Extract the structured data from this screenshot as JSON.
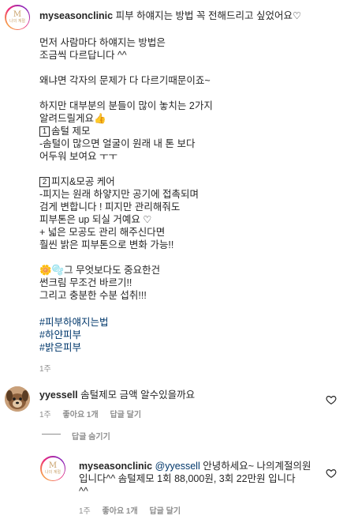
{
  "post": {
    "username": "myseasonclinic",
    "logo_text": "나의 계절",
    "first_line": "피부 하얘지는 방법 꼭 전해드리고 싶었어요♡",
    "lines": [
      "먼저 사람마다 하얘지는 방법은",
      "조금씩 다르답니다 ^^",
      "",
      "왜냐면 각자의 문제가 다 다르기때문이죠~",
      "",
      "하지만 대부분의 분들이 많이 놓치는 2가지",
      "알려드릴게요👍",
      "",
      "-솜털이 많으면 얼굴이 원래 내 톤 보다",
      "어두워 보여요 ㅜㅜ",
      "",
      "",
      "-피지는 원래 하얗지만 공기에 접촉되며",
      "검게 변합니다 ! 피지만 관리해줘도",
      "피부톤은 up 되실 거예요 ♡",
      "+ 넓은 모공도 관리 해주신다면",
      "훨씬 밝은 피부톤으로 변화 가능!!",
      "",
      "🌼🫧그 무엇보다도 중요한건",
      "썬크림 무조건 바르기!!",
      "그리고 충분한 수분 섭취!!!"
    ],
    "item1_num": "1",
    "item1_title": "솜털 제모",
    "item2_num": "2",
    "item2_title": "피지&모공 케어",
    "hashtags": [
      "#피부하얘지는법",
      "#하얀피부",
      "#밝은피부"
    ],
    "time": "1주"
  },
  "comment": {
    "username": "yyessell",
    "text": "솜털제모 금액 알수있을까요",
    "time": "1주",
    "likes": "좋아요 1개",
    "reply": "답글 달기"
  },
  "hide_replies": "답글 숨기기",
  "reply": {
    "username": "myseasonclinic",
    "logo_text": "나의 계절",
    "mention": "@yyessell",
    "text1": "안녕하세요~ 나의계절의원",
    "text2": "입니다^^ 솜털제모 1회 88,000원, 3회 22만원 입니다",
    "text3": "^^",
    "time": "1주",
    "likes": "좋아요 1개",
    "reply": "답글 달기"
  }
}
